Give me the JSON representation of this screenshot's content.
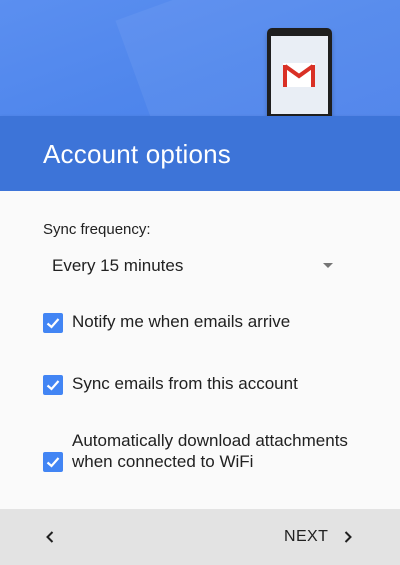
{
  "header": {
    "title": "Account options"
  },
  "illustration": {
    "icon": "gmail-logo-icon",
    "colors": {
      "header_top": "#4f86ec",
      "header_bottom": "#3d74d8",
      "gmail_red": "#d93025"
    }
  },
  "sync": {
    "label": "Sync frequency:",
    "selected": "Every 15 minutes"
  },
  "options": [
    {
      "label": "Notify me when emails arrive",
      "checked": true
    },
    {
      "label": "Sync emails from this account",
      "checked": true
    },
    {
      "label": "Automatically download attachments when connected to WiFi",
      "checked": true
    }
  ],
  "footer": {
    "back_icon": "chevron-left-icon",
    "next_label": "NEXT",
    "next_icon": "chevron-right-icon"
  },
  "theme": {
    "accent": "#4285f4",
    "footer_bg": "#e3e3e3"
  }
}
